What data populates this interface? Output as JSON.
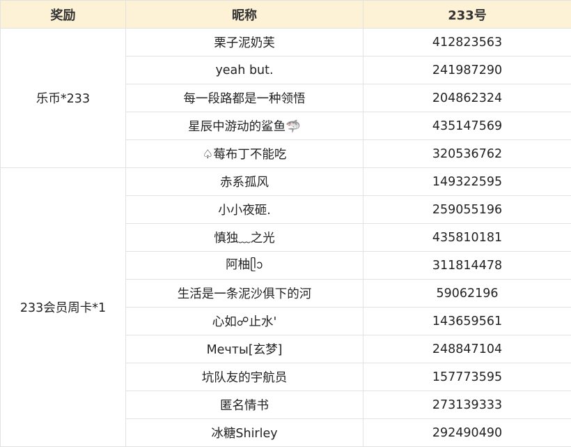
{
  "header": {
    "reward": "奖励",
    "nickname": "昵称",
    "id": "233号"
  },
  "groups": [
    {
      "reward": "乐币*233",
      "rows": [
        {
          "nickname": "栗子泥奶芙",
          "id": "412823563"
        },
        {
          "nickname": "yeah but.",
          "id": "241987290"
        },
        {
          "nickname": "每一段路都是一种领悟",
          "id": "204862324"
        },
        {
          "nickname": "星辰中游动的鲨鱼🦈",
          "id": "435147569"
        },
        {
          "nickname": "♤莓布丁不能吃",
          "id": "320536762"
        }
      ]
    },
    {
      "reward": "233会员周卡*1",
      "rows": [
        {
          "nickname": "赤系孤风",
          "id": "149322595"
        },
        {
          "nickname": "小小夜砸.",
          "id": "259055196"
        },
        {
          "nickname": "慎独﹏之光",
          "id": "435810181"
        },
        {
          "nickname": "阿柚ᥫᩣ",
          "id": "311814478"
        },
        {
          "nickname": "生活是一条泥沙俱下的河",
          "id": "59062196"
        },
        {
          "nickname": "心如☍止水'",
          "id": "143659561"
        },
        {
          "nickname": "Мечты[玄梦]",
          "id": "248847104"
        },
        {
          "nickname": "坑队友的宇航员",
          "id": "157773595"
        },
        {
          "nickname": "匿名情书",
          "id": "273139333"
        },
        {
          "nickname": "冰糖Shirley",
          "id": "292490490"
        }
      ]
    }
  ]
}
